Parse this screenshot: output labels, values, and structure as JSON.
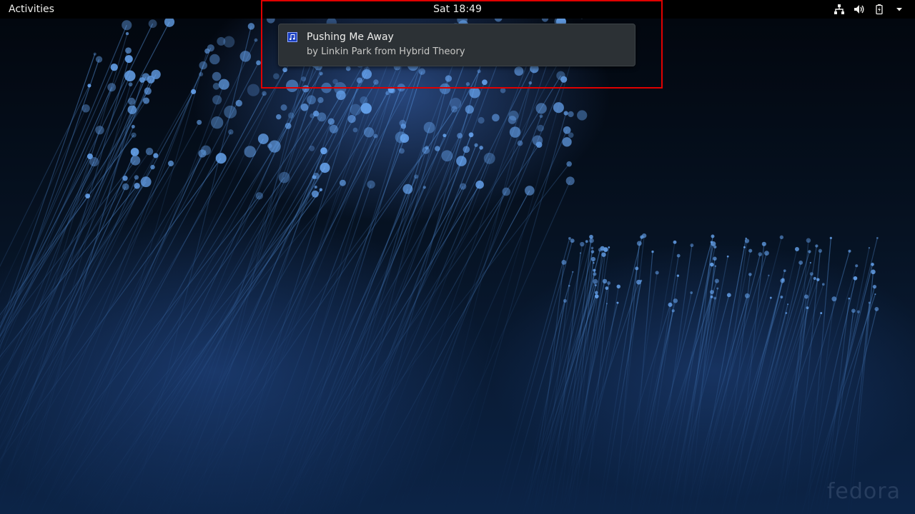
{
  "topbar": {
    "activities_label": "Activities",
    "clock": "Sat 18:49",
    "status_icons": [
      "network-icon",
      "volume-icon",
      "battery-icon",
      "system-menu-arrow-icon"
    ]
  },
  "notification": {
    "icon": "music-note-icon",
    "title": "Pushing Me Away",
    "body": "by Linkin Park from Hybrid Theory"
  },
  "wallpaper": {
    "logo_text": "fedora"
  },
  "colors": {
    "topbar_bg": "#000000",
    "notification_bg": "#2c3135",
    "highlight": "#e00000",
    "wallpaper_accent": "#4a8de0"
  }
}
